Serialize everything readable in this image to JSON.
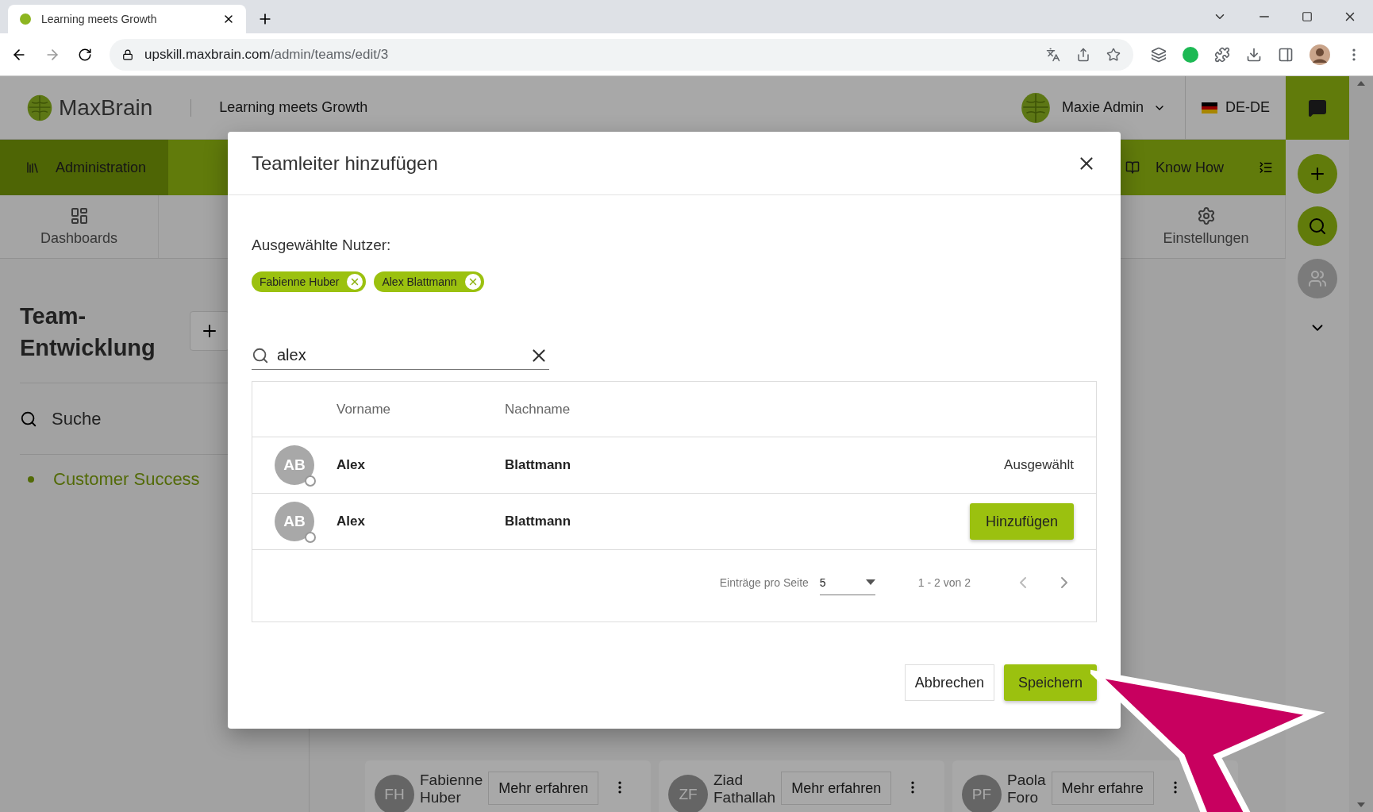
{
  "browser": {
    "tab_title": "Learning meets Growth",
    "url_host": "upskill.maxbrain.com",
    "url_path": "/admin/teams/edit/3"
  },
  "header": {
    "logo": "**Max**Brain",
    "tagline": "Learning meets Growth",
    "user": "Maxie Admin",
    "language": "DE-DE"
  },
  "nav": [
    {
      "label": "Administration",
      "selected": true
    },
    {
      "label": "Know How",
      "selected": false
    }
  ],
  "subnav": [
    {
      "label": "Dashboards",
      "kind": "dashboards"
    },
    {
      "label": "Einstellungen",
      "kind": "settings"
    }
  ],
  "sidebar": {
    "title": "Team-Entwicklung",
    "search": "Suche",
    "teams": [
      {
        "label": "Customer Success",
        "selected": true
      }
    ]
  },
  "cards": [
    {
      "initials": "FH",
      "name": "Fabienne Huber",
      "button": "Mehr erfahren"
    },
    {
      "initials": "ZF",
      "name": "Ziad Fathallah",
      "button": "Mehr erfahren"
    },
    {
      "initials": "PF",
      "name": "Paola Foro",
      "button": "Mehr erfahre"
    }
  ],
  "dialog": {
    "title": "Teamleiter hinzufügen",
    "selected_label": "Ausgewählte Nutzer:",
    "chips": [
      {
        "label": "Fabienne Huber"
      },
      {
        "label": "Alex Blattmann"
      }
    ],
    "search": {
      "value": "alex"
    },
    "columns": [
      "Vorname",
      "Nachname"
    ],
    "rows": [
      {
        "initials": "AB",
        "first": "Alex",
        "last": "Blattmann",
        "kind": "status",
        "status": "Ausgewählt"
      },
      {
        "initials": "AB",
        "first": "Alex",
        "last": "Blattmann",
        "kind": "action",
        "action": "Hinzufügen"
      }
    ],
    "paging": {
      "per_page_label": "Einträge pro Seite",
      "per_page": "5",
      "range": "1 - 2 von 2"
    },
    "cancel": "Abbrechen",
    "save": "Speichern"
  }
}
